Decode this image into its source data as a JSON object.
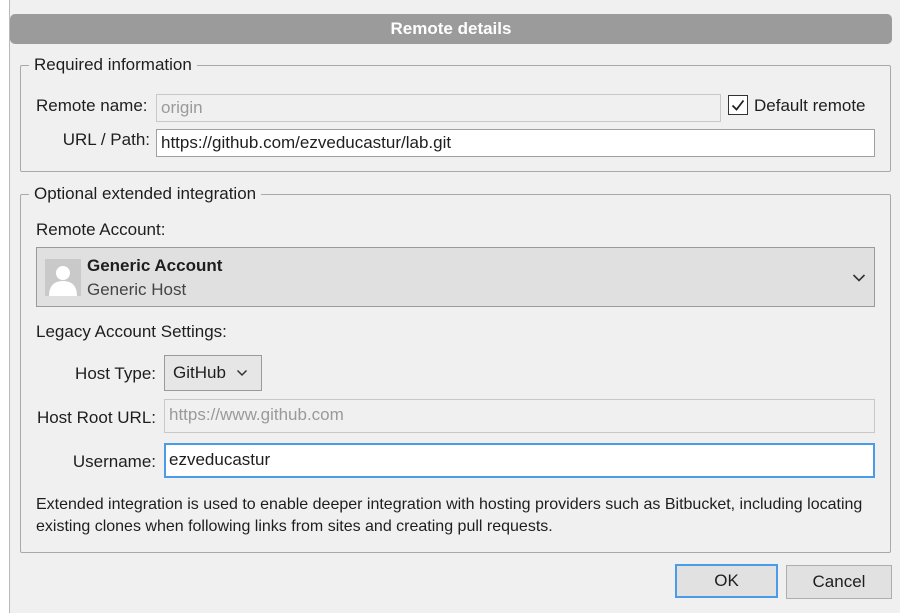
{
  "dialog": {
    "title": "Remote details"
  },
  "required": {
    "legend": "Required information",
    "remote_name_label": "Remote name:",
    "remote_name_value": "origin",
    "default_remote_label": "Default remote",
    "default_remote_checked": true,
    "url_label": "URL / Path:",
    "url_value": "https://github.com/ezveducastur/lab.git"
  },
  "optional": {
    "legend": "Optional extended integration",
    "remote_account_label": "Remote Account:",
    "account": {
      "name": "Generic Account",
      "host": "Generic Host"
    },
    "legacy_label": "Legacy Account Settings:",
    "host_type_label": "Host Type:",
    "host_type_value": "GitHub",
    "host_root_label": "Host Root URL:",
    "host_root_placeholder": "https://www.github.com",
    "username_label": "Username:",
    "username_value": "ezveducastur",
    "info_text": "Extended integration is used to enable deeper integration with hosting providers such as Bitbucket, including locating existing clones when following links from sites and creating pull requests."
  },
  "buttons": {
    "ok": "OK",
    "cancel": "Cancel"
  },
  "colors": {
    "accent": "#4a9be8",
    "title_bar": "#9b9b9b"
  },
  "icons": [
    "check-icon",
    "avatar-icon",
    "chevron-down-icon"
  ]
}
